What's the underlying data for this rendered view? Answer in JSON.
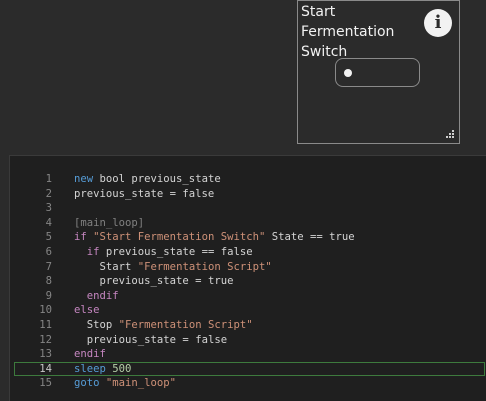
{
  "widget": {
    "title": "Start Fermentation Switch",
    "info_icon": "info-icon",
    "info_glyph": "i",
    "toggle_state": "off"
  },
  "editor": {
    "colors": {
      "keyword": "#569cd6",
      "flow": "#c586c0",
      "string": "#ce9178",
      "label": "#808080",
      "number": "#b5cea8",
      "plain": "#d4d4d4",
      "active_line_border": "#3d7a3d"
    },
    "active_line": 14,
    "lines": [
      {
        "num": "1",
        "indent": "",
        "tokens": [
          [
            "keyword",
            "new"
          ],
          [
            "plain",
            " bool previous_state"
          ]
        ]
      },
      {
        "num": "2",
        "indent": "",
        "tokens": [
          [
            "plain",
            "previous_state = false"
          ]
        ]
      },
      {
        "num": "3",
        "indent": "",
        "tokens": []
      },
      {
        "num": "4",
        "indent": "",
        "tokens": [
          [
            "label",
            "[main_loop]"
          ]
        ]
      },
      {
        "num": "5",
        "indent": "",
        "tokens": [
          [
            "flow",
            "if "
          ],
          [
            "string",
            "\"Start Fermentation Switch\""
          ],
          [
            "plain",
            " State == true"
          ]
        ]
      },
      {
        "num": "6",
        "indent": "  ",
        "tokens": [
          [
            "flow",
            "if"
          ],
          [
            "plain",
            " previous_state == false"
          ]
        ]
      },
      {
        "num": "7",
        "indent": "    ",
        "tokens": [
          [
            "plain",
            "Start "
          ],
          [
            "string",
            "\"Fermentation Script\""
          ]
        ]
      },
      {
        "num": "8",
        "indent": "    ",
        "tokens": [
          [
            "plain",
            "previous_state = true"
          ]
        ]
      },
      {
        "num": "9",
        "indent": "  ",
        "tokens": [
          [
            "flow",
            "endif"
          ]
        ]
      },
      {
        "num": "10",
        "indent": "",
        "tokens": [
          [
            "flow",
            "else"
          ]
        ]
      },
      {
        "num": "11",
        "indent": "  ",
        "tokens": [
          [
            "plain",
            "Stop "
          ],
          [
            "string",
            "\"Fermentation Script\""
          ]
        ]
      },
      {
        "num": "12",
        "indent": "  ",
        "tokens": [
          [
            "plain",
            "previous_state = false"
          ]
        ]
      },
      {
        "num": "13",
        "indent": "",
        "tokens": [
          [
            "flow",
            "endif"
          ]
        ]
      },
      {
        "num": "14",
        "indent": "",
        "tokens": [
          [
            "keyword",
            "sleep"
          ],
          [
            "plain",
            " "
          ],
          [
            "number",
            "500"
          ]
        ]
      },
      {
        "num": "15",
        "indent": "",
        "tokens": [
          [
            "keyword",
            "goto"
          ],
          [
            "plain",
            " "
          ],
          [
            "string",
            "\"main_loop\""
          ]
        ]
      }
    ]
  }
}
